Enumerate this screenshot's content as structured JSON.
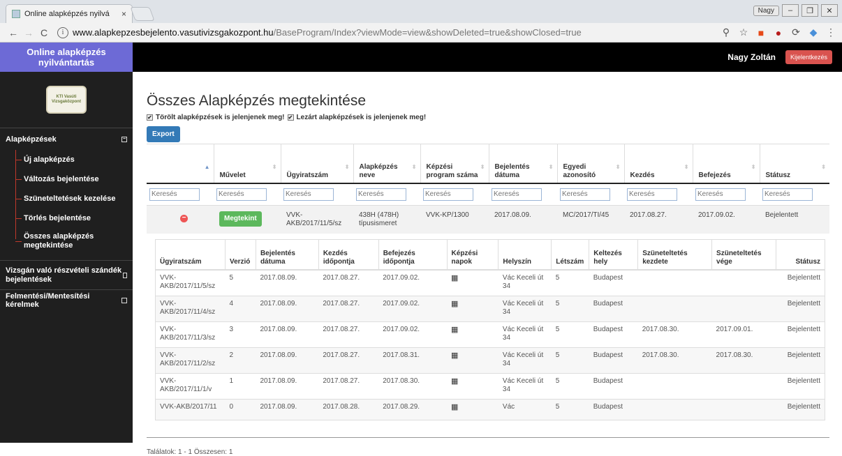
{
  "browser": {
    "tab_title": "Online alapképzés nyilvá",
    "tab_close": "×",
    "window_user": "Nagy",
    "url_host": "www.alapkepzesbejelento.vasutivizsgakozpont.hu",
    "url_path": "/BaseProgram/Index?viewMode=view&showDeleted=true&showClosed=true"
  },
  "sidebar": {
    "brand": "Online alapképzés nyilvántartás",
    "logo_text": "KTI Vasúti Vizsgaközpont",
    "section_alapkepzesek": "Alapképzések",
    "items": [
      {
        "label": "Új alapképzés"
      },
      {
        "label": "Változás bejelentése"
      },
      {
        "label": "Szüneteltetések kezelése"
      },
      {
        "label": "Törlés bejelentése"
      },
      {
        "label": "Összes alapképzés megtekintése"
      }
    ],
    "section_vizsga": "Vizsgán való részvételi szándék bejelentések",
    "section_felmentes": "Felmentési/Mentesítési kérelmek"
  },
  "topbar": {
    "user_name": "Nagy Zoltán",
    "logout_label": "Kijelentkezés"
  },
  "main": {
    "title": "Összes Alapképzés megtekintése",
    "filter_deleted": "Törölt alapképzések is jelenjenek meg!",
    "filter_closed": "Lezárt alapképzések is jelenjenek meg!",
    "export_label": "Export",
    "search_placeholder": "Keresés",
    "columns": [
      "",
      "Művelet",
      "Ügyiratszám",
      "Alapképzés neve",
      "Képzési program száma",
      "Bejelentés dátuma",
      "Egyedi azonosító",
      "Kezdés",
      "Befejezés",
      "Státusz"
    ],
    "row": {
      "action_label": "Megtekint",
      "ugyiratszam": "VVK-AKB/2017/11/5/sz",
      "nev": "438H (478H) típusismeret",
      "program": "VVK-KP/1300",
      "bejelentes": "2017.08.09.",
      "azonosito": "MC/2017/TI/45",
      "kezdes": "2017.08.27.",
      "befejezes": "2017.09.02.",
      "statusz": "Bejelentett"
    },
    "footer": "Találatok: 1 - 1 Összesen: 1"
  },
  "detail": {
    "columns": [
      "Ügyiratszám",
      "Verzió",
      "Bejelentés dátuma",
      "Kezdés időpontja",
      "Befejezés időpontja",
      "Képzési napok",
      "Helyszín",
      "Létszám",
      "Keltezés hely",
      "Szüneteltetés kezdete",
      "Szüneteltetés vége",
      "Státusz"
    ],
    "rows": [
      {
        "ugy": "VVK-AKB/2017/11/5/sz",
        "ver": "5",
        "bej": "2017.08.09.",
        "kezd": "2017.08.27.",
        "bef": "2017.09.02.",
        "hely": "Vác Keceli út 34",
        "let": "5",
        "kelt": "Budapest",
        "szk": "",
        "szv": "",
        "stat": "Bejelentett"
      },
      {
        "ugy": "VVK-AKB/2017/11/4/sz",
        "ver": "4",
        "bej": "2017.08.09.",
        "kezd": "2017.08.27.",
        "bef": "2017.09.02.",
        "hely": "Vác Keceli út 34",
        "let": "5",
        "kelt": "Budapest",
        "szk": "",
        "szv": "",
        "stat": "Bejelentett"
      },
      {
        "ugy": "VVK-AKB/2017/11/3/sz",
        "ver": "3",
        "bej": "2017.08.09.",
        "kezd": "2017.08.27.",
        "bef": "2017.09.02.",
        "hely": "Vác Keceli út 34",
        "let": "5",
        "kelt": "Budapest",
        "szk": "2017.08.30.",
        "szv": "2017.09.01.",
        "stat": "Bejelentett"
      },
      {
        "ugy": "VVK-AKB/2017/11/2/sz",
        "ver": "2",
        "bej": "2017.08.09.",
        "kezd": "2017.08.27.",
        "bef": "2017.08.31.",
        "hely": "Vác Keceli út 34",
        "let": "5",
        "kelt": "Budapest",
        "szk": "2017.08.30.",
        "szv": "2017.08.30.",
        "stat": "Bejelentett"
      },
      {
        "ugy": "VVK-AKB/2017/11/1/v",
        "ver": "1",
        "bej": "2017.08.09.",
        "kezd": "2017.08.27.",
        "bef": "2017.08.30.",
        "hely": "Vác Keceli út 34",
        "let": "5",
        "kelt": "Budapest",
        "szk": "",
        "szv": "",
        "stat": "Bejelentett"
      },
      {
        "ugy": "VVK-AKB/2017/11",
        "ver": "0",
        "bej": "2017.08.09.",
        "kezd": "2017.08.28.",
        "bef": "2017.08.29.",
        "hely": "Vác",
        "let": "5",
        "kelt": "Budapest",
        "szk": "",
        "szv": "",
        "stat": "Bejelentett"
      }
    ]
  }
}
